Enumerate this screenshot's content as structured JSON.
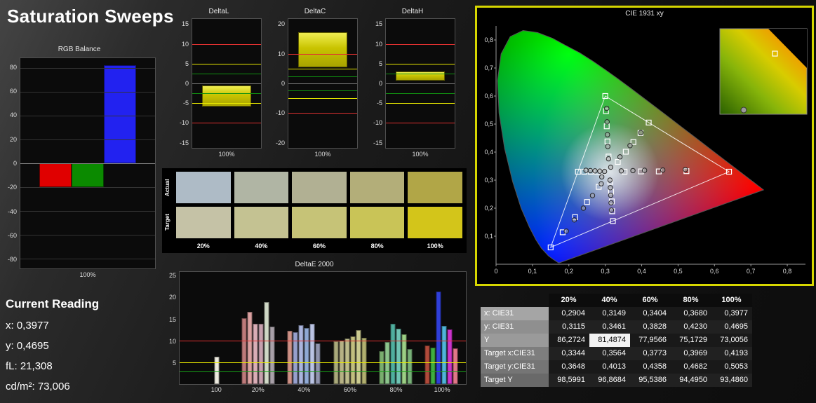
{
  "page_title": "Saturation Sweeps",
  "current_reading": {
    "title": "Current Reading",
    "lines": [
      "x: 0,3977",
      "y: 0,4695",
      "fL: 21,308",
      "cd/m²: 73,006"
    ]
  },
  "swatches": {
    "col_labels": [
      "20%",
      "40%",
      "60%",
      "80%",
      "100%"
    ],
    "rows": [
      {
        "label": "Actual",
        "colors": [
          "#aebbc6",
          "#b0b5a4",
          "#b1b093",
          "#b3ae79",
          "#b1a647"
        ]
      },
      {
        "label": "Target",
        "colors": [
          "#c5c2a6",
          "#c4c292",
          "#c6c377",
          "#c9c457",
          "#d3c51a"
        ]
      }
    ]
  },
  "table": {
    "columns": [
      "20%",
      "40%",
      "60%",
      "80%",
      "100%"
    ],
    "rows": [
      {
        "label": "x: CIE31",
        "values": [
          "0,2904",
          "0,3149",
          "0,3404",
          "0,3680",
          "0,3977"
        ]
      },
      {
        "label": "y: CIE31",
        "values": [
          "0,3115",
          "0,3461",
          "0,3828",
          "0,4230",
          "0,4695"
        ]
      },
      {
        "label": "Y",
        "values": [
          "86,2724",
          "81,4874",
          "77,9566",
          "75,1729",
          "73,0056"
        ],
        "highlight_col": 1
      },
      {
        "label": "Target x:CIE31",
        "values": [
          "0,3344",
          "0,3564",
          "0,3773",
          "0,3969",
          "0,4193"
        ]
      },
      {
        "label": "Target y:CIE31",
        "values": [
          "0,3648",
          "0,4013",
          "0,4358",
          "0,4682",
          "0,5053"
        ]
      },
      {
        "label": "Target Y",
        "values": [
          "98,5991",
          "96,8684",
          "95,5386",
          "94,4950",
          "93,4860"
        ]
      }
    ]
  },
  "chart_data": [
    {
      "id": "rgb-balance",
      "type": "bar",
      "title": "RGB Balance",
      "xlabel": "100%",
      "ylim": [
        -80,
        80
      ],
      "render_ylim": [
        -88,
        88
      ],
      "yticks": [
        80,
        60,
        40,
        20,
        0,
        -20,
        -40,
        -60,
        -80
      ],
      "categories": [
        "red",
        "green",
        "blue"
      ],
      "values": [
        -20,
        -20,
        82
      ],
      "colors": [
        "#e00000",
        "#0b8a00",
        "#2222f0"
      ]
    },
    {
      "id": "delta-l",
      "type": "bar",
      "title": "DeltaL",
      "xlabel": "100%",
      "ylim": [
        -15,
        15
      ],
      "render_ylim": [
        -16.5,
        16.5
      ],
      "yticks": [
        15,
        10,
        5,
        0,
        -5,
        -10,
        -15
      ],
      "bar": {
        "from": -6,
        "to": -0.5,
        "color": "#d6d300"
      },
      "ref_lines": [
        {
          "y": 10,
          "color": "#e03030"
        },
        {
          "y": 5,
          "color": "#e8e800"
        },
        {
          "y": 2.5,
          "color": "#109010"
        },
        {
          "y": -2.5,
          "color": "#109010"
        },
        {
          "y": -5,
          "color": "#e8e800"
        },
        {
          "y": -10,
          "color": "#e03030"
        }
      ]
    },
    {
      "id": "delta-c",
      "type": "bar",
      "title": "DeltaC",
      "xlabel": "100%",
      "ylim": [
        -20,
        20
      ],
      "render_ylim": [
        -22,
        22
      ],
      "yticks": [
        20,
        10,
        0,
        -10,
        -20
      ],
      "bar": {
        "from": 5.5,
        "to": 17.5,
        "color": "#d6d300"
      },
      "ref_lines": [
        {
          "y": 10,
          "color": "#e03030"
        },
        {
          "y": 5,
          "color": "#e8e800"
        },
        {
          "y": 2.5,
          "color": "#109010"
        },
        {
          "y": -2.5,
          "color": "#109010"
        },
        {
          "y": -5,
          "color": "#e8e800"
        },
        {
          "y": -10,
          "color": "#e03030"
        }
      ]
    },
    {
      "id": "delta-h",
      "type": "bar",
      "title": "DeltaH",
      "xlabel": "100%",
      "ylim": [
        -15,
        15
      ],
      "render_ylim": [
        -16.5,
        16.5
      ],
      "yticks": [
        15,
        10,
        5,
        0,
        -5,
        -10,
        -15
      ],
      "bar": {
        "from": 0.8,
        "to": 3,
        "color": "#d6d300"
      },
      "ref_lines": [
        {
          "y": 10,
          "color": "#e03030"
        },
        {
          "y": 5,
          "color": "#e8e800"
        },
        {
          "y": 2.5,
          "color": "#109010"
        },
        {
          "y": -2.5,
          "color": "#109010"
        },
        {
          "y": -5,
          "color": "#e8e800"
        },
        {
          "y": -10,
          "color": "#e03030"
        }
      ]
    },
    {
      "id": "deltae-2000",
      "type": "bar",
      "title": "DeltaE 2000",
      "ylim": [
        0,
        25
      ],
      "render_ylim": [
        0,
        26
      ],
      "yticks": [
        25,
        20,
        15,
        10,
        5
      ],
      "ref_lines": [
        {
          "y": 10,
          "color": "#e03030"
        },
        {
          "y": 5,
          "color": "#e8e800"
        },
        {
          "y": 3,
          "color": "#18a018"
        }
      ],
      "group_centers": [
        13,
        27.5,
        43.5,
        59.5,
        75.5,
        91.5
      ],
      "groups": [
        {
          "label": "100",
          "bars": [
            {
              "value": 6.3,
              "color": "#eceadf"
            }
          ]
        },
        {
          "label": "20%",
          "bars": [
            {
              "value": 15.3,
              "color": "#bd7a7a"
            },
            {
              "value": 16.7,
              "color": "#dba1a1"
            },
            {
              "value": 14.0,
              "color": "#d9adb6"
            },
            {
              "value": 13.9,
              "color": "#c6a0ae"
            },
            {
              "value": 19.0,
              "color": "#cfd8c6"
            },
            {
              "value": 13.4,
              "color": "#a8a0a8"
            }
          ]
        },
        {
          "label": "40%",
          "bars": [
            {
              "value": 12.4,
              "color": "#cf9186"
            },
            {
              "value": 12.1,
              "color": "#97a0cc"
            },
            {
              "value": 13.6,
              "color": "#aab4dd"
            },
            {
              "value": 13.0,
              "color": "#8fa9d4"
            },
            {
              "value": 13.9,
              "color": "#bac3e3"
            },
            {
              "value": 9.5,
              "color": "#9094ae"
            }
          ]
        },
        {
          "label": "60%",
          "bars": [
            {
              "value": 9.9,
              "color": "#a9a97a"
            },
            {
              "value": 10.1,
              "color": "#b6b184"
            },
            {
              "value": 10.5,
              "color": "#bdbb8b"
            },
            {
              "value": 11.1,
              "color": "#c1be7e"
            },
            {
              "value": 12.5,
              "color": "#cbcb90"
            },
            {
              "value": 10.8,
              "color": "#b1af6f"
            }
          ]
        },
        {
          "label": "80%",
          "bars": [
            {
              "value": 7.7,
              "color": "#79ad6e"
            },
            {
              "value": 9.7,
              "color": "#8cc48c"
            },
            {
              "value": 14.0,
              "color": "#4fae9e"
            },
            {
              "value": 12.9,
              "color": "#6fc4b4"
            },
            {
              "value": 11.6,
              "color": "#9ccf84"
            },
            {
              "value": 8.2,
              "color": "#77b077"
            }
          ]
        },
        {
          "label": "100%",
          "bars": [
            {
              "value": 9.0,
              "color": "#b04a3a"
            },
            {
              "value": 8.4,
              "color": "#3fae3f"
            },
            {
              "value": 21.4,
              "color": "#2f3fd9"
            },
            {
              "value": 13.5,
              "color": "#4fb4d9"
            },
            {
              "value": 12.6,
              "color": "#cc33cc"
            },
            {
              "value": 8.3,
              "color": "#e07788"
            }
          ]
        }
      ]
    },
    {
      "id": "cie-1931",
      "type": "scatter",
      "title": "CIE 1931 xy",
      "xlim": [
        0,
        0.85
      ],
      "ylim": [
        0,
        0.85
      ],
      "xticks": [
        "0",
        "0,1",
        "0,2",
        "0,3",
        "0,4",
        "0,5",
        "0,6",
        "0,7",
        "0,8"
      ],
      "yticks": [
        "0,1",
        "0,2",
        "0,3",
        "0,4",
        "0,5",
        "0,6",
        "0,7",
        "0,8"
      ],
      "gamut_triangle": [
        [
          0.64,
          0.33
        ],
        [
          0.3,
          0.6
        ],
        [
          0.15,
          0.06
        ]
      ],
      "sweeps": [
        {
          "name": "red",
          "target": [
            [
              0.353,
              0.33
            ],
            [
              0.398,
              0.331
            ],
            [
              0.447,
              0.331
            ],
            [
              0.523,
              0.332
            ],
            [
              0.64,
              0.33
            ]
          ],
          "measured": [
            [
              0.344,
              0.333
            ],
            [
              0.376,
              0.334
            ],
            [
              0.408,
              0.335
            ],
            [
              0.458,
              0.336
            ],
            [
              0.52,
              0.338
            ]
          ]
        },
        {
          "name": "green",
          "target": [
            [
              0.309,
              0.384
            ],
            [
              0.306,
              0.438
            ],
            [
              0.304,
              0.492
            ],
            [
              0.302,
              0.546
            ],
            [
              0.3,
              0.6
            ]
          ],
          "measured": [
            [
              0.309,
              0.376
            ],
            [
              0.307,
              0.42
            ],
            [
              0.306,
              0.462
            ],
            [
              0.305,
              0.508
            ],
            [
              0.304,
              0.556
            ]
          ]
        },
        {
          "name": "blue",
          "target": [
            [
              0.282,
              0.276
            ],
            [
              0.25,
              0.222
            ],
            [
              0.217,
              0.168
            ],
            [
              0.183,
              0.114
            ],
            [
              0.15,
              0.06
            ]
          ],
          "measured": [
            [
              0.289,
              0.287
            ],
            [
              0.265,
              0.245
            ],
            [
              0.24,
              0.2
            ],
            [
              0.215,
              0.158
            ],
            [
              0.193,
              0.118
            ]
          ]
        },
        {
          "name": "cyan",
          "target": [
            [
              0.295,
              0.33
            ],
            [
              0.277,
              0.33
            ],
            [
              0.26,
              0.33
            ],
            [
              0.242,
              0.33
            ],
            [
              0.225,
              0.33
            ]
          ],
          "measured": [
            [
              0.298,
              0.331
            ],
            [
              0.285,
              0.332
            ],
            [
              0.272,
              0.333
            ],
            [
              0.259,
              0.334
            ],
            [
              0.247,
              0.335
            ]
          ]
        },
        {
          "name": "magenta",
          "target": [
            [
              0.314,
              0.294
            ],
            [
              0.316,
              0.259
            ],
            [
              0.318,
              0.224
            ],
            [
              0.319,
              0.189
            ],
            [
              0.321,
              0.154
            ]
          ],
          "measured": [
            [
              0.313,
              0.3
            ],
            [
              0.314,
              0.273
            ],
            [
              0.315,
              0.246
            ],
            [
              0.316,
              0.219
            ],
            [
              0.317,
              0.193
            ]
          ]
        },
        {
          "name": "yellow",
          "target": [
            [
              0.3344,
              0.3648
            ],
            [
              0.3564,
              0.4013
            ],
            [
              0.3773,
              0.4358
            ],
            [
              0.3969,
              0.4682
            ],
            [
              0.4193,
              0.5053
            ]
          ],
          "measured": [
            [
              0.2904,
              0.3115
            ],
            [
              0.3149,
              0.3461
            ],
            [
              0.3404,
              0.3828
            ],
            [
              0.368,
              0.423
            ],
            [
              0.3977,
              0.4695
            ]
          ]
        }
      ]
    }
  ]
}
